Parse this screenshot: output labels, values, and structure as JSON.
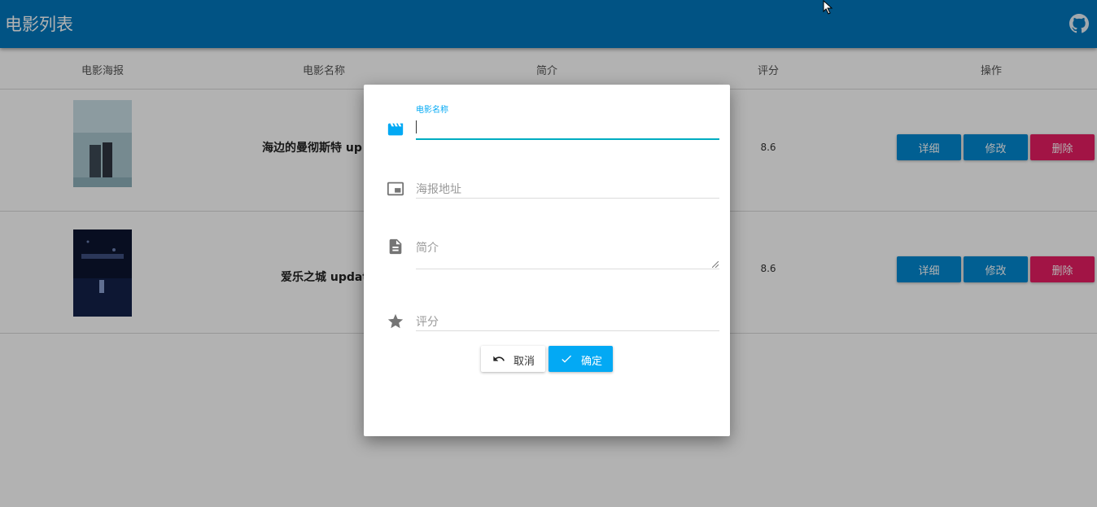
{
  "header": {
    "title": "电影列表",
    "github_icon": "github-icon"
  },
  "table": {
    "columns": [
      "电影海报",
      "电影名称",
      "简介",
      "评分",
      "操作"
    ],
    "rows": [
      {
        "name": "海边的曼彻斯特 up",
        "rating": "8.6"
      },
      {
        "name": "爱乐之城 updat",
        "rating": "8.6"
      }
    ],
    "actions": {
      "detail": "详细",
      "edit": "修改",
      "delete": "删除"
    }
  },
  "dialog": {
    "name_label": "电影名称",
    "poster_placeholder": "海报地址",
    "intro_placeholder": "简介",
    "rating_placeholder": "评分",
    "cancel_label": "取消",
    "ok_label": "确定"
  },
  "colors": {
    "appbar": "#0277bd",
    "primary": "#0288d1",
    "danger": "#e91e63",
    "accent": "#03a9f4"
  }
}
